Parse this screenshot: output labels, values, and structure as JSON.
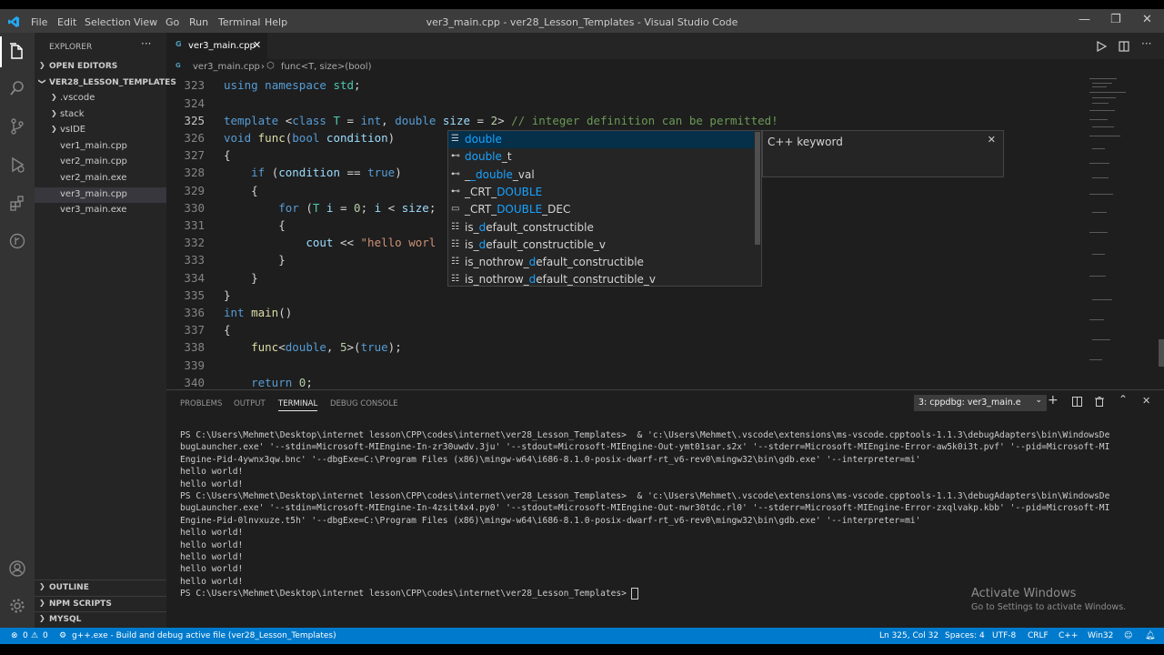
{
  "window": {
    "title": "ver3_main.cpp - ver28_Lesson_Templates - Visual Studio Code",
    "menu": [
      "File",
      "Edit",
      "Selection",
      "View",
      "Go",
      "Run",
      "Terminal",
      "Help"
    ]
  },
  "sidebar": {
    "explorer_label": "EXPLORER",
    "open_editors": "OPEN EDITORS",
    "folder": "VER28_LESSON_TEMPLATES",
    "items": [
      {
        "label": ".vscode",
        "folder": true
      },
      {
        "label": "stack",
        "folder": true
      },
      {
        "label": "vsIDE",
        "folder": true
      },
      {
        "label": "ver1_main.cpp",
        "folder": false
      },
      {
        "label": "ver2_main.cpp",
        "folder": false
      },
      {
        "label": "ver2_main.exe",
        "folder": false
      },
      {
        "label": "ver3_main.cpp",
        "folder": false,
        "selected": true
      },
      {
        "label": "ver3_main.exe",
        "folder": false
      }
    ],
    "outline": "OUTLINE",
    "npm_scripts": "NPM SCRIPTS",
    "mysql": "MYSQL"
  },
  "editor": {
    "tab_label": "ver3_main.cpp",
    "breadcrumb_file": "ver3_main.cpp",
    "breadcrumb_symbol": "func<T, size>(bool)",
    "line_numbers": [
      "323",
      "324",
      "325",
      "326",
      "327",
      "328",
      "329",
      "330",
      "331",
      "332",
      "333",
      "334",
      "335",
      "336",
      "337",
      "338",
      "339",
      "340"
    ]
  },
  "suggest": {
    "items": [
      {
        "icon": "keyword-icon",
        "pre": "",
        "hl": "double",
        "post": ""
      },
      {
        "icon": "typedef-icon",
        "pre": "",
        "hl": "double",
        "post": "_t"
      },
      {
        "icon": "typedef-icon",
        "pre": "_",
        "hl": "_double",
        "post": "_val"
      },
      {
        "icon": "typedef-icon",
        "pre": "_CRT_",
        "hl": "DOUBLE",
        "post": ""
      },
      {
        "icon": "macro-icon",
        "pre": "_CRT_",
        "hl": "DOUBLE",
        "post": "_DEC"
      },
      {
        "icon": "struct-icon",
        "pre": "is_",
        "hl": "d",
        "post": "efault_constructible"
      },
      {
        "icon": "struct-icon",
        "pre": "is_",
        "hl": "d",
        "post": "efault_constructible_v"
      },
      {
        "icon": "struct-icon",
        "pre": "is_nothrow_",
        "hl": "d",
        "post": "efault_constructible"
      },
      {
        "icon": "struct-icon",
        "pre": "is_nothrow_",
        "hl": "d",
        "post": "efault_constructible_v"
      }
    ],
    "detail": "C++ keyword"
  },
  "panel": {
    "tabs": [
      "PROBLEMS",
      "OUTPUT",
      "TERMINAL",
      "DEBUG CONSOLE"
    ],
    "active_tab": "TERMINAL",
    "terminal_select": "3: cppdbg: ver3_main.e",
    "lines": [
      "PS C:\\Users\\Mehmet\\Desktop\\internet lesson\\CPP\\codes\\internet\\ver28_Lesson_Templates>  & 'c:\\Users\\Mehmet\\.vscode\\extensions\\ms-vscode.cpptools-1.1.3\\debugAdapters\\bin\\WindowsDe",
      "bugLauncher.exe' '--stdin=Microsoft-MIEngine-In-zr30uwdv.3ju' '--stdout=Microsoft-MIEngine-Out-ymt01sar.s2x' '--stderr=Microsoft-MIEngine-Error-aw5k0i3t.pvf' '--pid=Microsoft-MI",
      "Engine-Pid-4ywnx3qw.bnc' '--dbgExe=C:\\Program Files (x86)\\mingw-w64\\i686-8.1.0-posix-dwarf-rt_v6-rev0\\mingw32\\bin\\gdb.exe' '--interpreter=mi'",
      "hello world!",
      "hello world!",
      "PS C:\\Users\\Mehmet\\Desktop\\internet lesson\\CPP\\codes\\internet\\ver28_Lesson_Templates>  & 'c:\\Users\\Mehmet\\.vscode\\extensions\\ms-vscode.cpptools-1.1.3\\debugAdapters\\bin\\WindowsDe",
      "bugLauncher.exe' '--stdin=Microsoft-MIEngine-In-4zsit4x4.py0' '--stdout=Microsoft-MIEngine-Out-nwr30tdc.rl0' '--stderr=Microsoft-MIEngine-Error-zxqlvakp.kbb' '--pid=Microsoft-MI",
      "Engine-Pid-0lnvxuze.t5h' '--dbgExe=C:\\Program Files (x86)\\mingw-w64\\i686-8.1.0-posix-dwarf-rt_v6-rev0\\mingw32\\bin\\gdb.exe' '--interpreter=mi'",
      "hello world!",
      "hello world!",
      "hello world!",
      "hello world!",
      "hello world!"
    ],
    "prompt": "PS C:\\Users\\Mehmet\\Desktop\\internet lesson\\CPP\\codes\\internet\\ver28_Lesson_Templates> "
  },
  "watermark": {
    "title": "Activate Windows",
    "subtitle": "Go to Settings to activate Windows."
  },
  "statusbar": {
    "errors": "0",
    "warnings": "0",
    "task": "g++.exe - Build and debug active file (ver28_Lesson_Templates)",
    "position": "Ln 325, Col 32",
    "spaces": "Spaces: 4",
    "encoding": "UTF-8",
    "eol": "CRLF",
    "language": "C++",
    "platform": "Win32"
  },
  "colors": {
    "accent": "#007acc",
    "keyword": "#569cd6",
    "type": "#4ec9b0",
    "function": "#dcdcaa",
    "string": "#ce9178",
    "comment": "#6a9955",
    "number": "#b5cea8"
  }
}
